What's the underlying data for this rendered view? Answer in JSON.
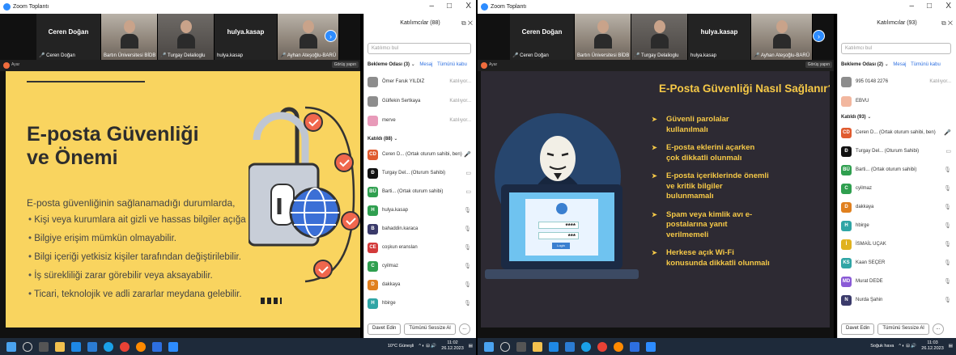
{
  "left": {
    "window_title": "Zoom Toplantı",
    "window_controls": [
      "–",
      "□",
      "X"
    ],
    "video_strip": [
      {
        "name_large": "Ceren Doğan",
        "label": "Ceren Doğan",
        "muted": true,
        "type": "name"
      },
      {
        "label": "Bartın Üniversitesi BİDB",
        "type": "cam"
      },
      {
        "label": "Turgay Delalioglu",
        "muted": true,
        "type": "cam"
      },
      {
        "name_large": "hulya.kasap",
        "label": "hulya.kasap",
        "type": "name"
      },
      {
        "label": "Ayhan Ateşoğlu-BARÜ",
        "muted": true,
        "type": "cam"
      }
    ],
    "next_arrow": "›",
    "share_label": "Ayar",
    "slide": {
      "title_line1": "E-posta Güvenliği",
      "title_line2": "ve Önemi",
      "intro": "E-posta güvenliğinin sağlanamadığı durumlarda,",
      "bullets": [
        "Kişi veya kurumlara ait gizli ve hassas bilgiler açığa çıkabilir.",
        "Bilgiye erişim mümkün olmayabilir.",
        "Bilgi içeriği yetkisiz kişiler tarafından değiştirilebilir.",
        "İş sürekliliği zarar görebilir veya aksayabilir.",
        "Ticari, teknolojik ve adli zararlar meydana gelebilir."
      ]
    },
    "gear_view": "Görüş yapın",
    "panel": {
      "title": "Katılımcılar (88)",
      "search_placeholder": "Katılımcı bul",
      "waiting_header": "Bekleme Odası (3)",
      "msg_label": "Mesaj",
      "accept_all_label": "Tümünü kabu",
      "waiting": [
        {
          "name": "Ömer Faruk YILDIZ",
          "status": "Katılıyor...",
          "avatar": "",
          "color": "#8d8d8d"
        },
        {
          "name": "Gülfekin Sertkaya",
          "status": "Katılıyor...",
          "avatar": "",
          "color": "#8d8d8d"
        },
        {
          "name": "merve",
          "status": "Katılıyor...",
          "avatar": "",
          "color": "#e07aa4"
        }
      ],
      "joined_header": "Katıldı (88)",
      "joined": [
        {
          "name": "Ceren D... (Ortak oturum sahibi, ben)",
          "avatar": "CD",
          "color": "#e05b2f",
          "icon": "🎤"
        },
        {
          "name": "Turgay Del... (Oturum Sahibi)",
          "avatar": "Ð",
          "color": "#111111",
          "icon": "▭"
        },
        {
          "name": "Barti... (Ortak oturum sahibi)",
          "avatar": "BÜ",
          "color": "#2f9f4f",
          "icon": "▭"
        },
        {
          "name": "hulya.kasap",
          "avatar": "H",
          "color": "#2f9f4f",
          "icon": "🎙"
        },
        {
          "name": "bahaddin.karaca",
          "avatar": "B",
          "color": "#3a3a6a",
          "icon": "🎙"
        },
        {
          "name": "coşkun eranslan",
          "avatar": "CE",
          "color": "#d33a3a",
          "icon": "🎙"
        },
        {
          "name": "cyilmaz",
          "avatar": "C",
          "color": "#2f9f4f",
          "icon": "🎙"
        },
        {
          "name": "dakkaya",
          "avatar": "D",
          "color": "#e0801f",
          "icon": "🎙"
        },
        {
          "name": "hbirge",
          "avatar": "H",
          "color": "#2fa5a5",
          "icon": "🎙"
        }
      ],
      "invite_label": "Davet Edin",
      "mute_all_label": "Tümünü Sessize Al",
      "more_label": "..."
    },
    "taskbar": {
      "weather": "10°C Güneşli",
      "time": "11:02",
      "date": "26.12.2023"
    }
  },
  "right": {
    "window_title": "Zoom Toplantı",
    "window_controls": [
      "–",
      "□",
      "X"
    ],
    "video_strip": [
      {
        "name_large": "Ceren Doğan",
        "label": "Ceren Doğan",
        "muted": true,
        "type": "name"
      },
      {
        "label": "Bartın Üniversitesi BİDB",
        "type": "cam"
      },
      {
        "label": "Turgay Delalioglu",
        "muted": true,
        "type": "cam"
      },
      {
        "name_large": "hulya.kasap",
        "label": "hulya.kasap",
        "type": "name"
      },
      {
        "label": "Ayhan Ateşoğlu-BARÜ",
        "muted": true,
        "type": "cam"
      }
    ],
    "next_arrow": "›",
    "share_label": "Ayar",
    "gear_view": "Görüş yapın",
    "slide": {
      "title": "E-Posta Güvenliği Nasıl Sağlanır?",
      "bullets": [
        [
          "Güvenli parolalar",
          "kullanılmalı"
        ],
        [
          "E-posta eklerini açarken",
          "çok dikkatli olunmalı"
        ],
        [
          "E-posta içeriklerinde önemli",
          "ve kritik bilgiler",
          "bulunmamalı"
        ],
        [
          "Spam veya kimlik avı e-",
          "postalarına yanıt",
          "verilmemeli"
        ],
        [
          "Herkese açık Wi-Fi",
          "konusunda dikkatli olunmalı"
        ]
      ],
      "login_mask1": "****",
      "login_mask2": "***",
      "login_button": "Login"
    },
    "panel": {
      "title": "Katılımcılar (93)",
      "search_placeholder": "Katılımcı bul",
      "waiting_header": "Bekleme Odası (2)",
      "msg_label": "Mesaj",
      "accept_all_label": "Tümünü kabu",
      "waiting": [
        {
          "name": "995 0148 2276",
          "status": "Katılıyor...",
          "avatar": "",
          "color": "#8d8d8d"
        },
        {
          "name": "EBVU",
          "status": "",
          "avatar": "",
          "color": "#e07a55"
        }
      ],
      "joined_header": "Katıldı (93)",
      "joined": [
        {
          "name": "Ceren D... (Ortak oturum sahibi, ben)",
          "avatar": "CD",
          "color": "#e05b2f",
          "icon": "🎤"
        },
        {
          "name": "Turgay Del... (Oturum Sahibi)",
          "avatar": "Ð",
          "color": "#111111",
          "icon": "▭"
        },
        {
          "name": "Barti... (Ortak oturum sahibi)",
          "avatar": "BÜ",
          "color": "#2f9f4f",
          "icon": "🎙"
        },
        {
          "name": "cyilmaz",
          "avatar": "C",
          "color": "#2f9f4f",
          "icon": "🎙"
        },
        {
          "name": "dakkaya",
          "avatar": "D",
          "color": "#e0801f",
          "icon": "🎙"
        },
        {
          "name": "hbirge",
          "avatar": "H",
          "color": "#2fa5a5",
          "icon": "🎙"
        },
        {
          "name": "İSMAİL UÇAK",
          "avatar": "İ",
          "color": "#e0b21f",
          "icon": "🎙"
        },
        {
          "name": "Kaan SEÇER",
          "avatar": "KS",
          "color": "#2fa5a5",
          "icon": "🎙"
        },
        {
          "name": "Murat DEDE",
          "avatar": "MD",
          "color": "#8a5ad6",
          "icon": "🎙"
        },
        {
          "name": "Nurda Şahin",
          "avatar": "N",
          "color": "#3a3a6a",
          "icon": "🎙"
        }
      ],
      "invite_label": "Davet Edin",
      "mute_all_label": "Tümünü Sessize Al",
      "more_label": "..."
    },
    "taskbar": {
      "weather": "Soğuk hava",
      "time": "11:03",
      "date": "26.12.2023"
    }
  }
}
